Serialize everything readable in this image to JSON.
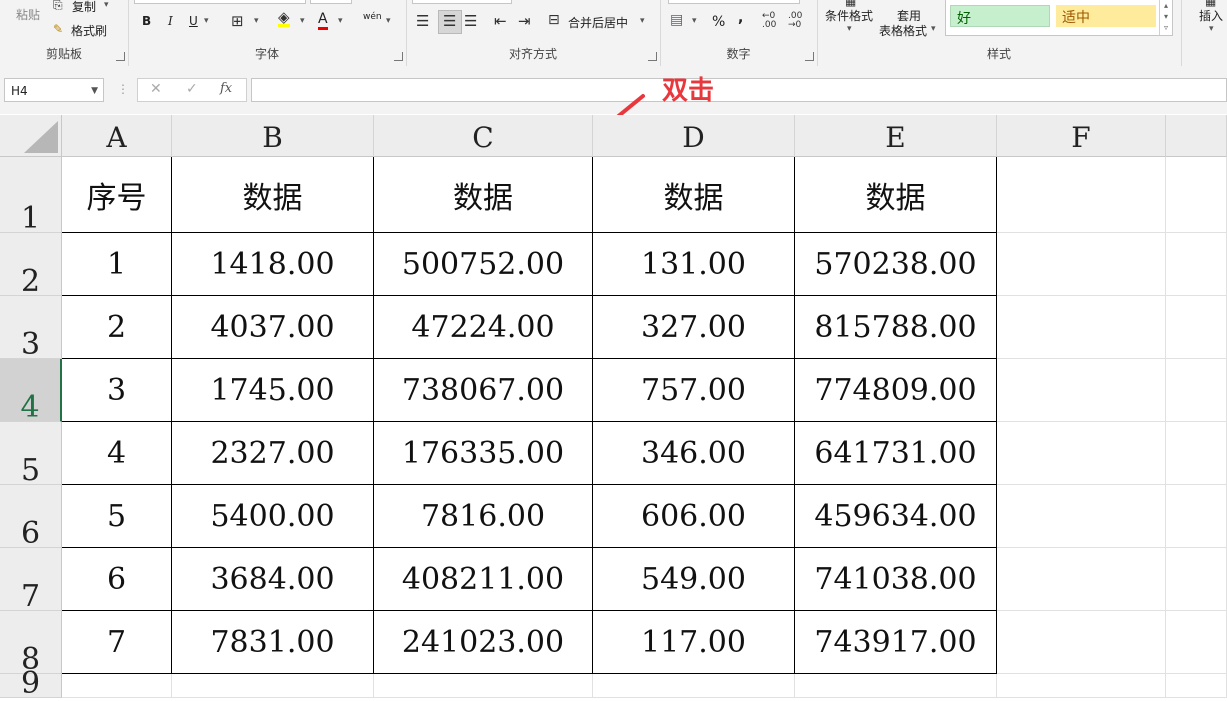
{
  "ribbon": {
    "clipboard": {
      "paste": "粘贴",
      "copy": "复制",
      "format_painter": "格式刷",
      "label": "剪贴板"
    },
    "font": {
      "bold": "B",
      "italic": "I",
      "underline": "U",
      "font_color": "A",
      "phonetic": "wén",
      "label": "字体"
    },
    "alignment": {
      "merge_center": "合并后居中",
      "label": "对齐方式"
    },
    "number": {
      "percent": "%",
      "comma": ",",
      "label": "数字"
    },
    "styles": {
      "conditional_format": "条件格式",
      "table_format_1": "套用",
      "table_format_2": "表格格式",
      "good": "好",
      "neutral": "适中",
      "label": "样式"
    },
    "cells": {
      "insert": "插入"
    }
  },
  "formula_bar": {
    "name_box": "H4",
    "fx": "fx",
    "cancel": "✕",
    "enter": "✓",
    "value": ""
  },
  "annotation": "双击",
  "sheet": {
    "columns": [
      "A",
      "B",
      "C",
      "D",
      "E",
      "F"
    ],
    "rows": [
      "1",
      "2",
      "3",
      "4",
      "5",
      "6",
      "7",
      "8",
      "9"
    ],
    "header": [
      "序号",
      "数据",
      "数据",
      "数据",
      "数据"
    ],
    "data": [
      [
        "1",
        "1418.00",
        "500752.00",
        "131.00",
        "570238.00"
      ],
      [
        "2",
        "4037.00",
        "47224.00",
        "327.00",
        "815788.00"
      ],
      [
        "3",
        "1745.00",
        "738067.00",
        "757.00",
        "774809.00"
      ],
      [
        "4",
        "2327.00",
        "176335.00",
        "346.00",
        "641731.00"
      ],
      [
        "5",
        "5400.00",
        "7816.00",
        "606.00",
        "459634.00"
      ],
      [
        "6",
        "3684.00",
        "408211.00",
        "549.00",
        "741038.00"
      ],
      [
        "7",
        "7831.00",
        "241023.00",
        "117.00",
        "743917.00"
      ]
    ]
  },
  "colors": {
    "accent": "#217346",
    "annotation": "#e8383d",
    "good_bg": "#c6efce",
    "neutral_bg": "#ffeb9c"
  }
}
